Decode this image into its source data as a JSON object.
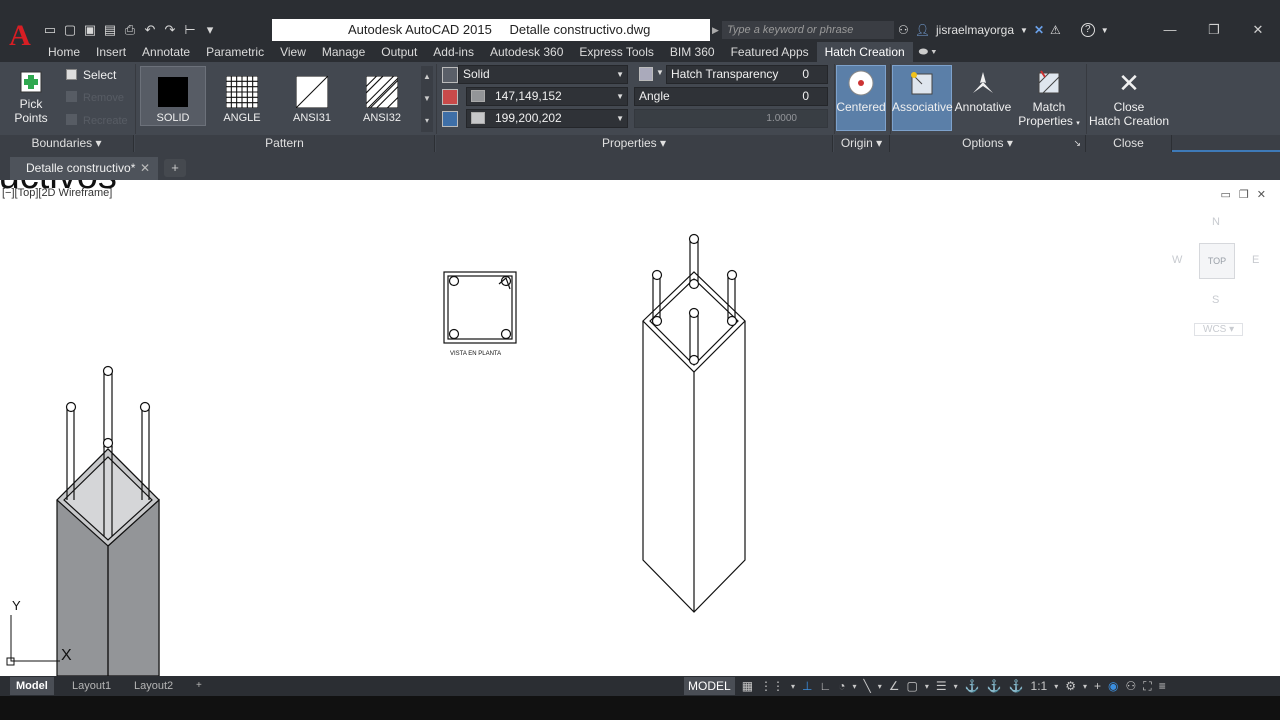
{
  "title_bar": {
    "app_name": "Autodesk AutoCAD 2015",
    "document_name": "Detalle constructivo.dwg",
    "search_placeholder": "Type a keyword or phrase",
    "username": "jisraelmayorga"
  },
  "ribbon_tabs": [
    "Home",
    "Insert",
    "Annotate",
    "Parametric",
    "View",
    "Manage",
    "Output",
    "Add-ins",
    "Autodesk 360",
    "Express Tools",
    "BIM 360",
    "Featured Apps",
    "Hatch Creation"
  ],
  "active_tab": "Hatch Creation",
  "ribbon": {
    "boundaries": {
      "label": "Boundaries",
      "pick_points": "Pick Points",
      "select": "Select",
      "remove": "Remove",
      "recreate": "Recreate"
    },
    "pattern": {
      "label": "Pattern",
      "swatches": [
        "SOLID",
        "ANGLE",
        "ANSI31",
        "ANSI32"
      ],
      "selected": "SOLID"
    },
    "properties": {
      "label": "Properties",
      "hatch_type": "Solid",
      "color1": "147,149,152",
      "color2": "199,200,202",
      "hatch_transparency_label": "Hatch Transparency",
      "hatch_transparency_value": "0",
      "angle_label": "Angle",
      "angle_value": "0",
      "scale_value": "1.0000"
    },
    "origin": {
      "label": "Origin",
      "centered": "Centered"
    },
    "options": {
      "label": "Options",
      "associative": "Associative",
      "annotative": "Annotative",
      "match_properties_line1": "Match",
      "match_properties_line2": "Properties"
    },
    "close": {
      "label": "Close",
      "close_line1": "Close",
      "close_line2": "Hatch Creation"
    }
  },
  "doc_tab": "Detalle constructivo*",
  "viewport_label": "[−][Top][2D Wireframe]",
  "drawing": {
    "plan_view_label": "VISTA EN PLANTA",
    "partial_text": "ructivos"
  },
  "viewcube": {
    "north": "N",
    "south": "S",
    "east": "E",
    "west": "W",
    "top": "TOP",
    "wcs": "WCS"
  },
  "ucs": {
    "y": "Y",
    "x": "X"
  },
  "layout_tabs": [
    "Model",
    "Layout1",
    "Layout2"
  ],
  "active_layout": "Model",
  "status_bar": {
    "model": "MODEL",
    "scale": "1:1"
  },
  "colors": {
    "ribbon_bg": "#434850",
    "titlebar_bg": "#2b2e33",
    "active_button": "#5b7fa8",
    "canvas_bg": "#ffffff",
    "hatch_fill": "#939598",
    "hatch_fill_light": "#c7c8ca"
  }
}
